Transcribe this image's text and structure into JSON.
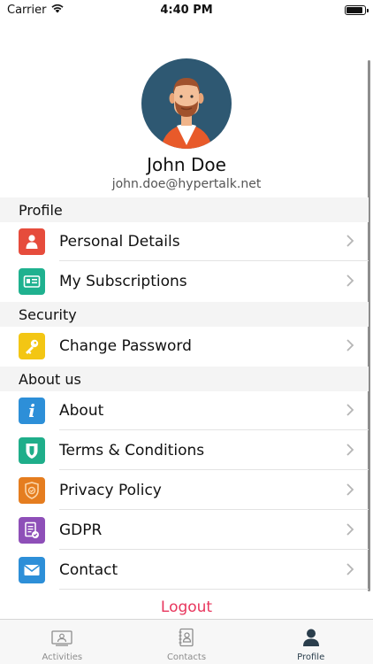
{
  "status_bar": {
    "carrier": "Carrier",
    "time": "4:40 PM"
  },
  "profile": {
    "name": "John Doe",
    "email": "john.doe@hypertalk.net"
  },
  "sections": {
    "profile": "Profile",
    "security": "Security",
    "about": "About us"
  },
  "rows": {
    "personal_details": "Personal Details",
    "my_subscriptions": "My Subscriptions",
    "change_password": "Change Password",
    "about": "About",
    "terms": "Terms & Conditions",
    "privacy": "Privacy Policy",
    "gdpr": "GDPR",
    "contact": "Contact"
  },
  "logout_label": "Logout",
  "tabs": {
    "activities": "Activities",
    "contacts": "Contacts",
    "profile": "Profile"
  },
  "colors": {
    "personal_details": "#e64c3c",
    "my_subscriptions": "#1fb18f",
    "change_password": "#f3c614",
    "about": "#2d8fd8",
    "terms": "#1fae8a",
    "privacy": "#e57d1f",
    "gdpr": "#8e4fb8",
    "contact": "#2d8fd8",
    "logout": "#e8365d",
    "avatar_bg": "#2e5872"
  },
  "icons": {
    "personal_details": "person-icon",
    "my_subscriptions": "id-card-icon",
    "change_password": "key-icon",
    "about": "info-icon",
    "terms": "shield-icon",
    "privacy": "shield-check-icon",
    "gdpr": "document-check-icon",
    "contact": "envelope-icon"
  }
}
